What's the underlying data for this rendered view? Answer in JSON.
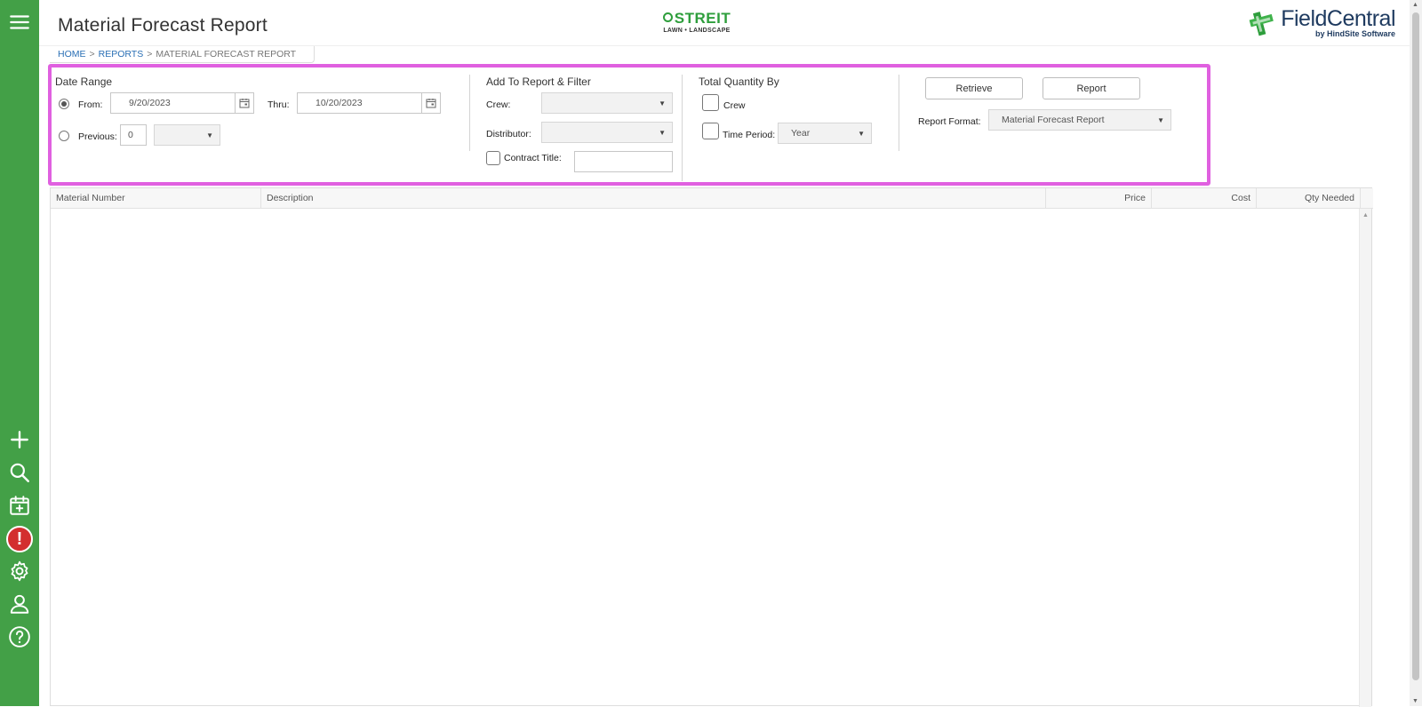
{
  "header": {
    "title": "Material Forecast Report",
    "brand_center_name": "STREIT",
    "brand_center_tagline": "LAWN • LANDSCAPE",
    "brand_right_name": "FieldCentral",
    "brand_right_tagline": "by HindSite Software"
  },
  "breadcrumb": {
    "home": "HOME",
    "sep": ">",
    "reports": "REPORTS",
    "current": "MATERIAL FORECAST REPORT"
  },
  "sidebar": {
    "items": [
      {
        "icon": "menu-icon"
      },
      {
        "icon": "plus-icon"
      },
      {
        "icon": "search-icon"
      },
      {
        "icon": "calendar-add-icon"
      },
      {
        "icon": "alert-icon",
        "label": "!"
      },
      {
        "icon": "gear-icon"
      },
      {
        "icon": "user-icon"
      },
      {
        "icon": "help-icon"
      }
    ]
  },
  "date_range": {
    "title": "Date Range",
    "from_label": "From:",
    "from_value": "9/20/2023",
    "thru_label": "Thru:",
    "thru_value": "10/20/2023",
    "previous_label": "Previous:",
    "previous_value": "0",
    "previous_unit": ""
  },
  "add_filter": {
    "title": "Add To Report & Filter",
    "crew_label": "Crew:",
    "crew_value": "",
    "distributor_label": "Distributor:",
    "distributor_value": "",
    "contract_label": "Contract Title:",
    "contract_value": ""
  },
  "total_qty": {
    "title": "Total Quantity By",
    "crew_label": "Crew",
    "time_period_label": "Time Period:",
    "time_period_value": "Year"
  },
  "actions": {
    "retrieve": "Retrieve",
    "report": "Report",
    "format_label": "Report Format:",
    "format_value": "Material Forecast Report"
  },
  "table": {
    "columns": [
      "Material Number",
      "Description",
      "Price",
      "Cost",
      "Qty Needed"
    ],
    "rows": []
  },
  "colors": {
    "sidebar": "#43a047",
    "highlight": "#e060e0",
    "link": "#2a6fb5"
  }
}
